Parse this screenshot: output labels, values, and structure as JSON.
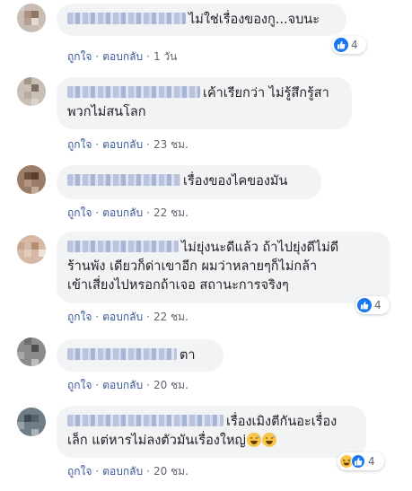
{
  "actions": {
    "like": "ถูกใจ",
    "reply": "ตอบกลับ",
    "dot": "·"
  },
  "comments": [
    {
      "text": "ไม่ใช่เรื่องของกู...จบนะ",
      "time": "1 วัน",
      "reaction_count": "4",
      "reaction_type": "like-icon"
    },
    {
      "text_line1": "เค้าเรียกว่า ไม่รู้สึกรู้สา",
      "text_line2": "พวกไม่สนโลก",
      "time": "23 ชม."
    },
    {
      "text": "เรื่องของไคของมัน",
      "time": "22 ชม."
    },
    {
      "text_line1": "ไม่ยุ่งนะดีแล้ว ถ้าไปยุ่งดีไม่ดี",
      "text_line2": "ร้านพัง เดียวก็ด่าเขาอีก ผมว่าหลายๆก็ไม่กล้า",
      "text_line3": "เข้าเสี่ยงไปหรอกถ้าเจอ สถานะการจริงๆ",
      "time": "22 ชม.",
      "reaction_count": "4",
      "reaction_type": "like-icon"
    },
    {
      "text": "ตา",
      "time": "20 ชม."
    },
    {
      "text_line1": "เรื่องเมิงตีกันอะเรื่อง",
      "text_line2": "เล็ก แต่หารไม่ลงตัวมันเรื่องใหญ่",
      "trailing_emoji": "grinning-sweat-emoji",
      "time": "20 ชม.",
      "reaction_count": "4",
      "reaction_types": [
        "haha-icon",
        "like-icon"
      ]
    }
  ],
  "colors": {
    "bubble": "#f2f3f5",
    "link": "#385898",
    "meta": "#606770",
    "like": "#1877f2"
  }
}
